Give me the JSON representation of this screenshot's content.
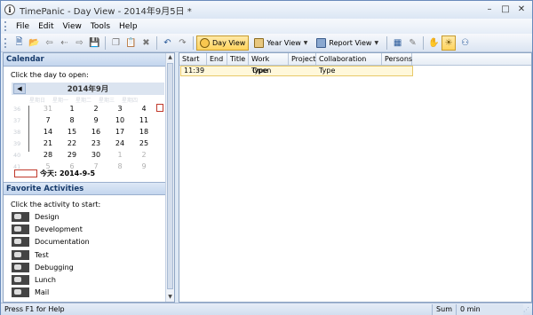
{
  "window": {
    "title": "TimePanic - Day View - 2014年9月5日 *"
  },
  "menu": [
    "File",
    "Edit",
    "View",
    "Tools",
    "Help"
  ],
  "toolbar": {
    "day_view": "Day View",
    "year_view": "Year View",
    "report_view": "Report View"
  },
  "calendar": {
    "header": "Calendar",
    "hint": "Click the day to open:",
    "month": "2014年9月",
    "day_headers": [
      "星期日",
      "星期一",
      "星期二",
      "星期三",
      "星期四"
    ],
    "week_numbers": [
      "36",
      "37",
      "38",
      "39",
      "40",
      "41"
    ],
    "rows": [
      [
        "31",
        "1",
        "2",
        "3",
        "4"
      ],
      [
        "7",
        "8",
        "9",
        "10",
        "11"
      ],
      [
        "14",
        "15",
        "16",
        "17",
        "18"
      ],
      [
        "21",
        "22",
        "23",
        "24",
        "25"
      ],
      [
        "28",
        "29",
        "30",
        "1",
        "2"
      ],
      [
        "5",
        "6",
        "7",
        "8",
        "9"
      ]
    ],
    "today_label": "今天: 2014-9-5"
  },
  "favorites": {
    "header": "Favorite Activities",
    "hint": "Click the activity to start:",
    "items": [
      "Design",
      "Development",
      "Documentation",
      "Test",
      "Debugging",
      "Lunch",
      "Mail"
    ]
  },
  "grid": {
    "columns": [
      "Start",
      "End",
      "Title",
      "Work Type",
      "Project",
      "Collaboration Type",
      "Persons"
    ],
    "rows": [
      {
        "start": "11:39",
        "end": "",
        "title": "",
        "work_type": "Open",
        "project": "",
        "collab": "",
        "persons": ""
      }
    ]
  },
  "status": {
    "left": "Press F1 for Help",
    "sum_label": "Sum",
    "sum_value": "0 min"
  }
}
